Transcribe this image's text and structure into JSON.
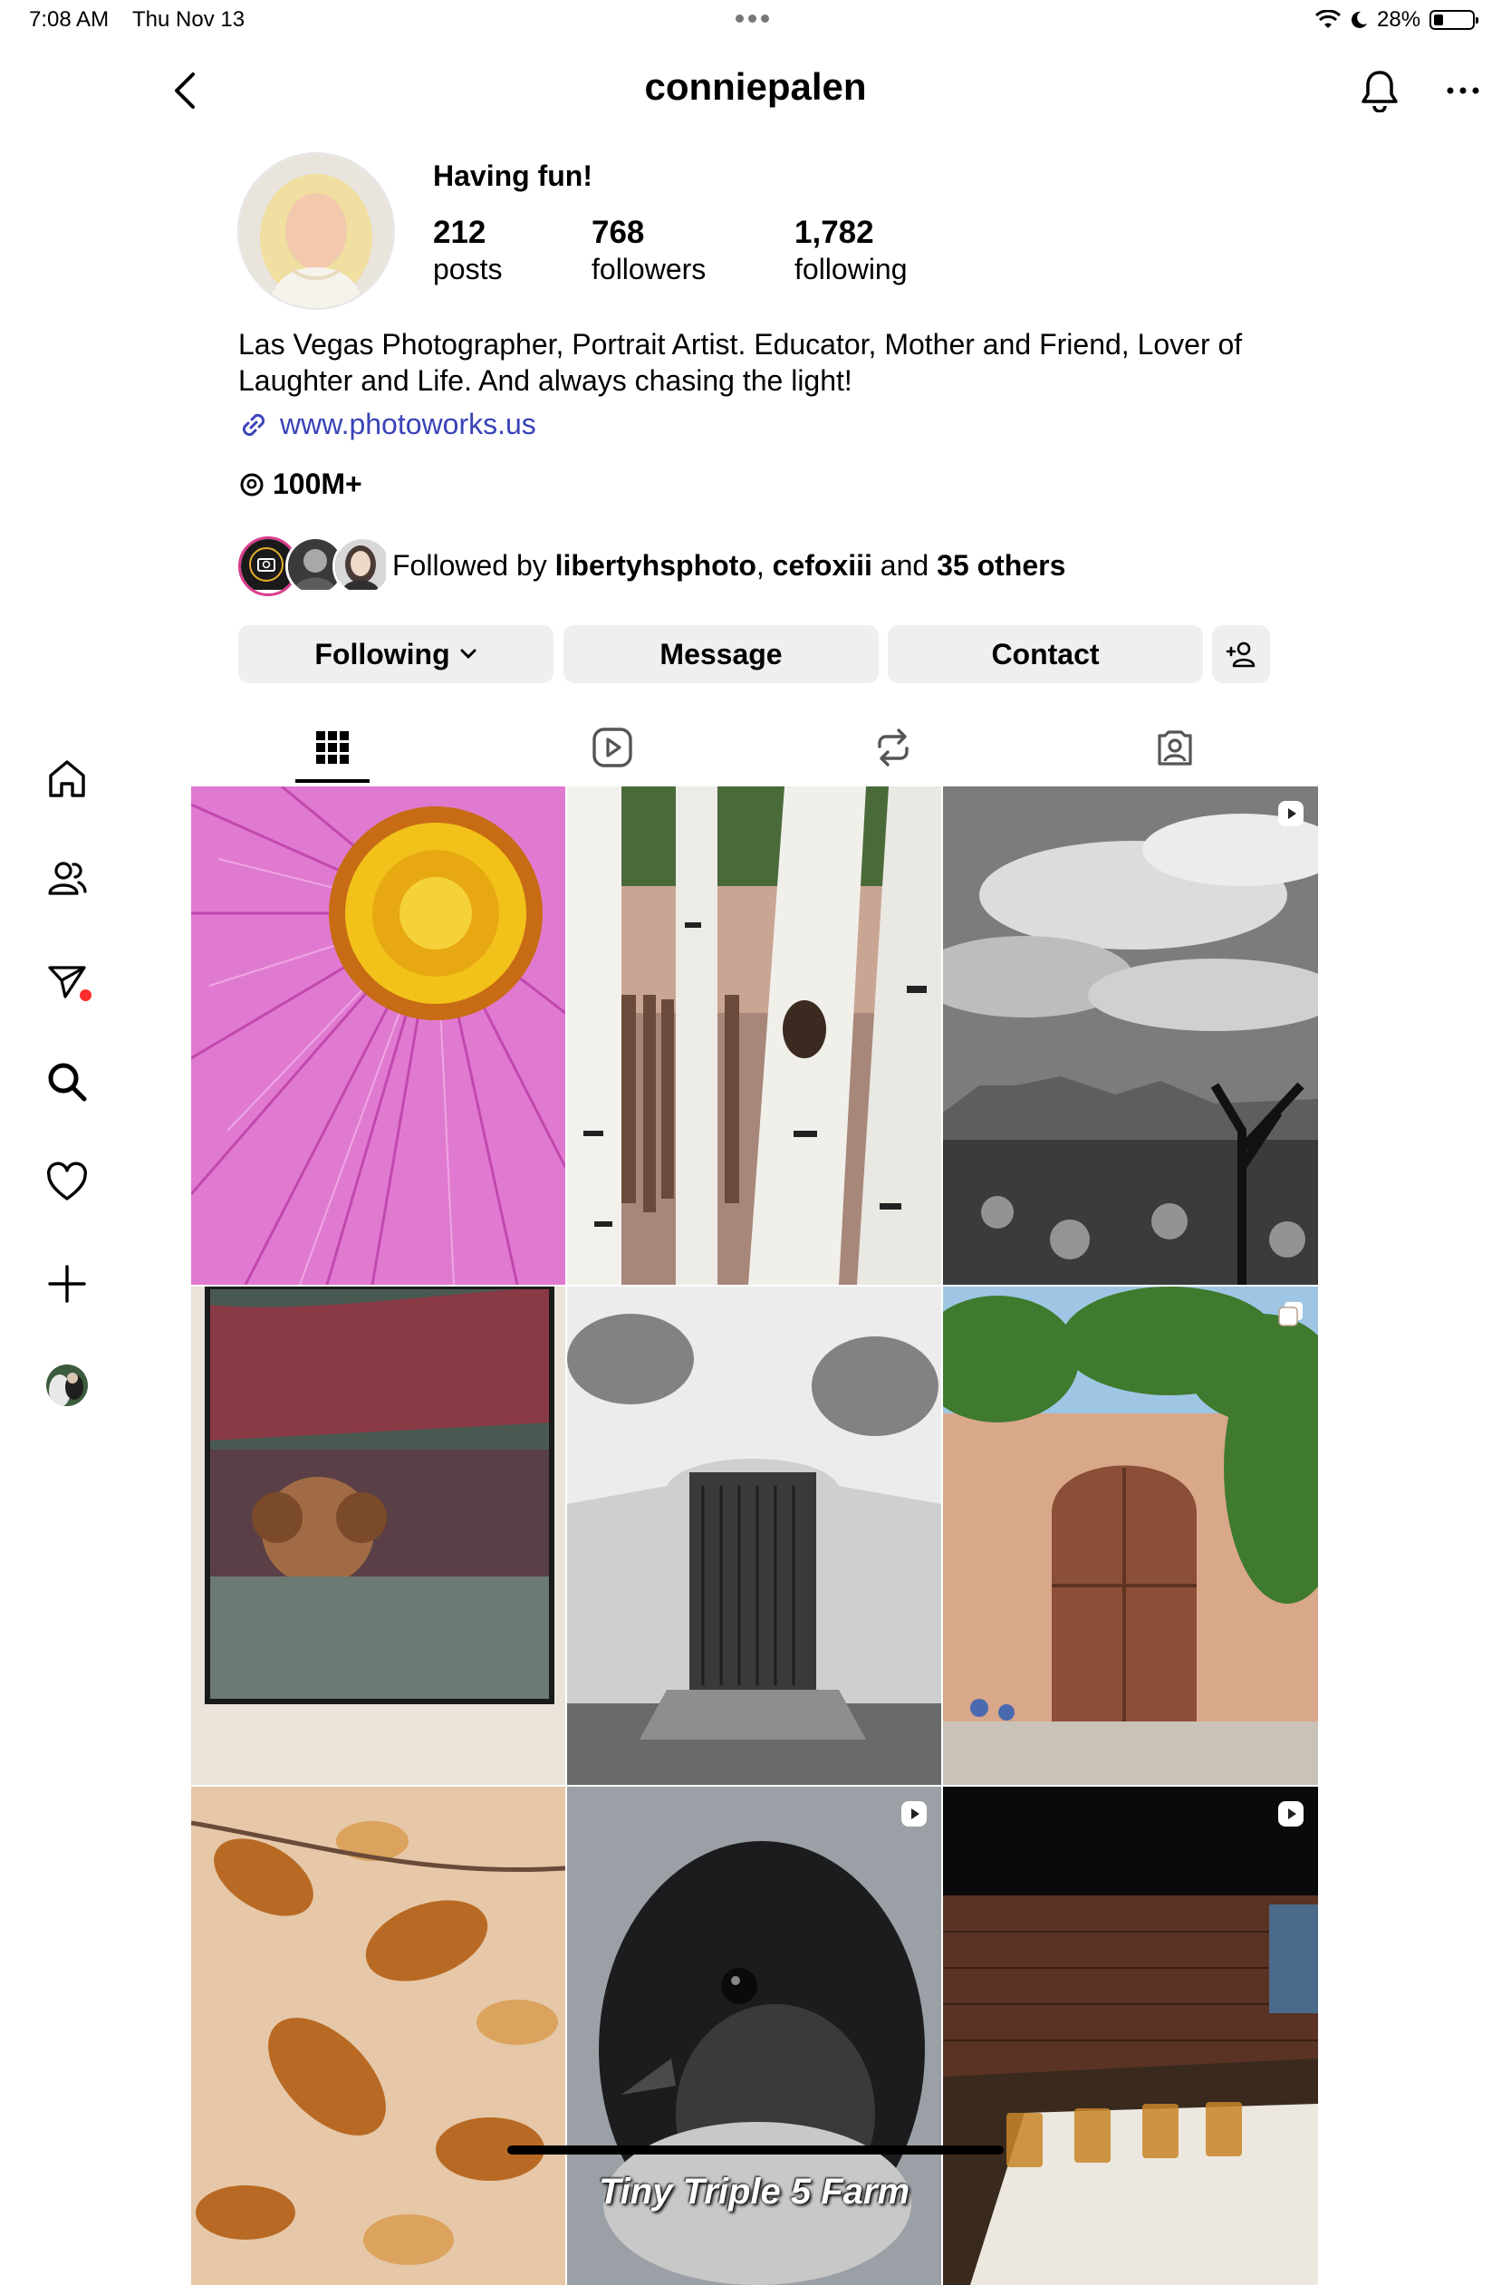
{
  "status_bar": {
    "time": "7:08 AM",
    "date": "Thu Nov 13",
    "battery": "28%"
  },
  "header": {
    "username": "conniepalen"
  },
  "profile": {
    "display_name": "Having fun!",
    "stats": [
      {
        "value": "212",
        "label": "posts"
      },
      {
        "value": "768",
        "label": "followers"
      },
      {
        "value": "1,782",
        "label": "following"
      }
    ],
    "bio": "Las Vegas Photographer, Portrait Artist. Educator, Mother and Friend, Lover of Laughter and Life. And always chasing the light!",
    "link": "www.photoworks.us",
    "threads": "100M+",
    "followed_by": {
      "prefix": "Followed by ",
      "user1": "libertyhsphoto",
      "sep": ", ",
      "user2": "cefoxiii",
      "and": " and ",
      "others": "35 others"
    }
  },
  "actions": {
    "following": "Following",
    "message": "Message",
    "contact": "Contact"
  },
  "tabs": [
    "grid-icon",
    "reels-icon",
    "reposts-icon",
    "tagged-icon"
  ],
  "sidebar": [
    "home-icon",
    "people-icon",
    "direct-icon",
    "search-icon",
    "heart-icon",
    "create-icon",
    "profile-avatar"
  ],
  "grid": {
    "caption_chick": "Tiny Triple 5 Farm",
    "posts": [
      {
        "subject": "pink cosmos flower",
        "badge": ""
      },
      {
        "subject": "aspen trunks",
        "badge": ""
      },
      {
        "subject": "black and white desert mountains",
        "badge": "reel"
      },
      {
        "subject": "dog behind window",
        "badge": ""
      },
      {
        "subject": "black and white adobe door",
        "badge": ""
      },
      {
        "subject": "adobe wall with wooden door",
        "badge": "carousel"
      },
      {
        "subject": "autumn leaves",
        "badge": ""
      },
      {
        "subject": "black chick",
        "badge": "reel"
      },
      {
        "subject": "whiskey tasting flight",
        "badge": "reel"
      }
    ]
  },
  "colors": {
    "link": "#3a44b8",
    "button_bg": "#efefef",
    "notification": "#ff2d2d"
  }
}
